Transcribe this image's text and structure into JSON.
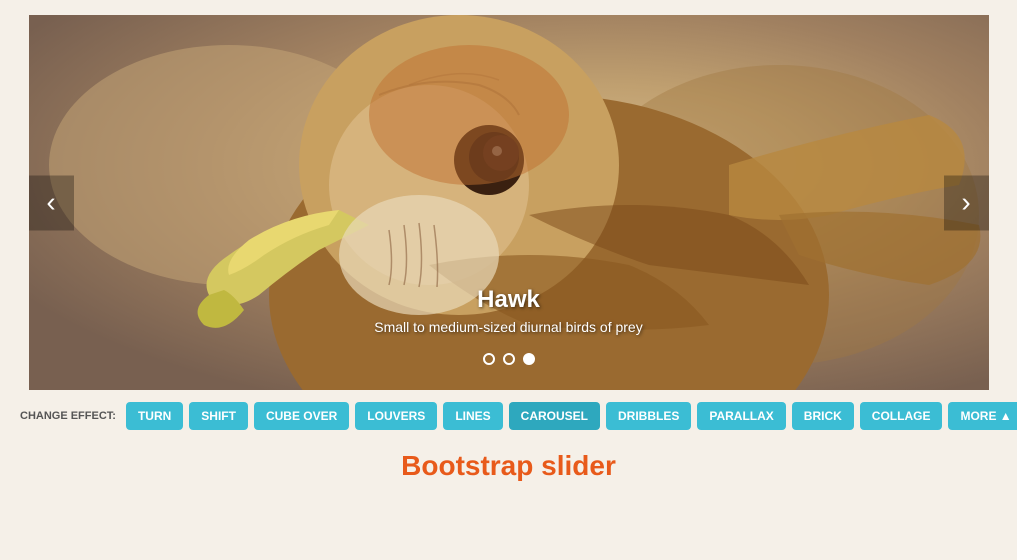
{
  "carousel": {
    "slide": {
      "title": "Hawk",
      "subtitle": "Small to medium-sized diurnal birds of prey"
    },
    "indicators": [
      {
        "active": false
      },
      {
        "active": false
      },
      {
        "active": true
      }
    ],
    "prev_label": "‹",
    "next_label": "›"
  },
  "controls": {
    "label": "CHANGE EFFECT:",
    "buttons": [
      {
        "id": "turn",
        "label": "TURN"
      },
      {
        "id": "shift",
        "label": "SHIFT"
      },
      {
        "id": "cube-over",
        "label": "CUBE OVER"
      },
      {
        "id": "louvers",
        "label": "LOUVERS"
      },
      {
        "id": "lines",
        "label": "LINES"
      },
      {
        "id": "carousel",
        "label": "CAROUSEL"
      },
      {
        "id": "dribbles",
        "label": "DRIBBLES"
      },
      {
        "id": "parallax",
        "label": "PARALLAX"
      },
      {
        "id": "brick",
        "label": "BRICK"
      },
      {
        "id": "collage",
        "label": "COLLAGE"
      },
      {
        "id": "more",
        "label": "MORE ▲"
      }
    ]
  },
  "footer": {
    "title": "Bootstrap slider"
  }
}
